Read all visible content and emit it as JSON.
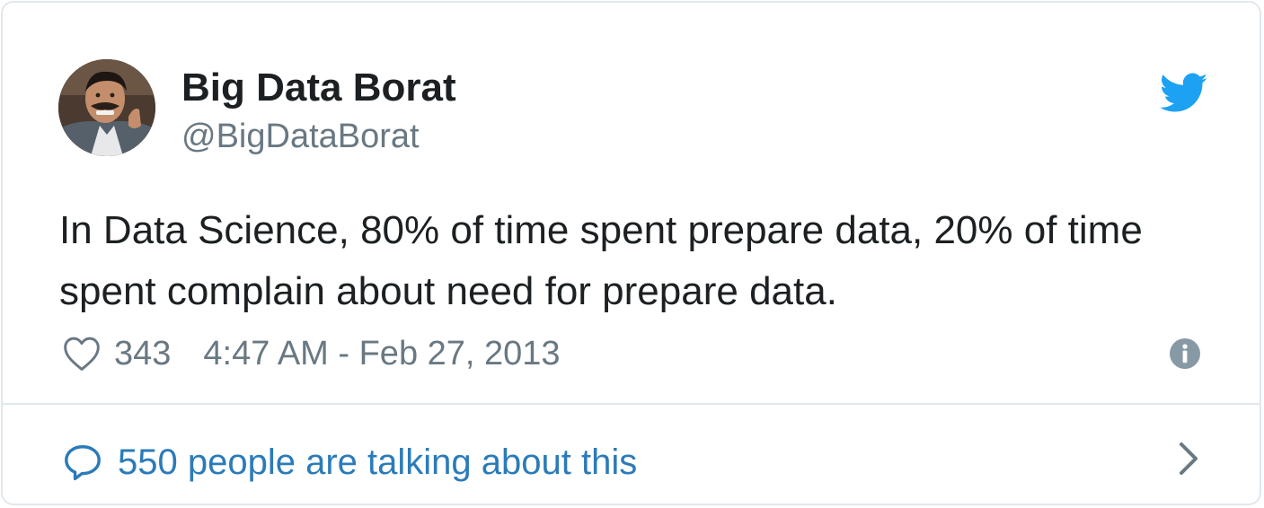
{
  "author": {
    "name": "Big Data Borat",
    "handle": "@BigDataBorat",
    "avatar_icon": "profile-photo"
  },
  "tweet": {
    "text": "In Data Science, 80% of time spent prepare data, 20% of time spent complain about need for prepare data.",
    "like_count": "343",
    "timestamp": "4:47 AM - Feb 27, 2013"
  },
  "footer": {
    "conversation_text": "550 people are talking about this"
  },
  "icons": {
    "brand": "twitter-bird-icon",
    "like": "heart-icon",
    "info": "info-icon",
    "reply": "speech-bubble-icon",
    "more": "chevron-right-icon"
  },
  "colors": {
    "brand_blue": "#1da1f2",
    "link_blue": "#2b7bb9",
    "text": "#1c2022",
    "secondary": "#697882",
    "border": "#e1e8ed"
  }
}
